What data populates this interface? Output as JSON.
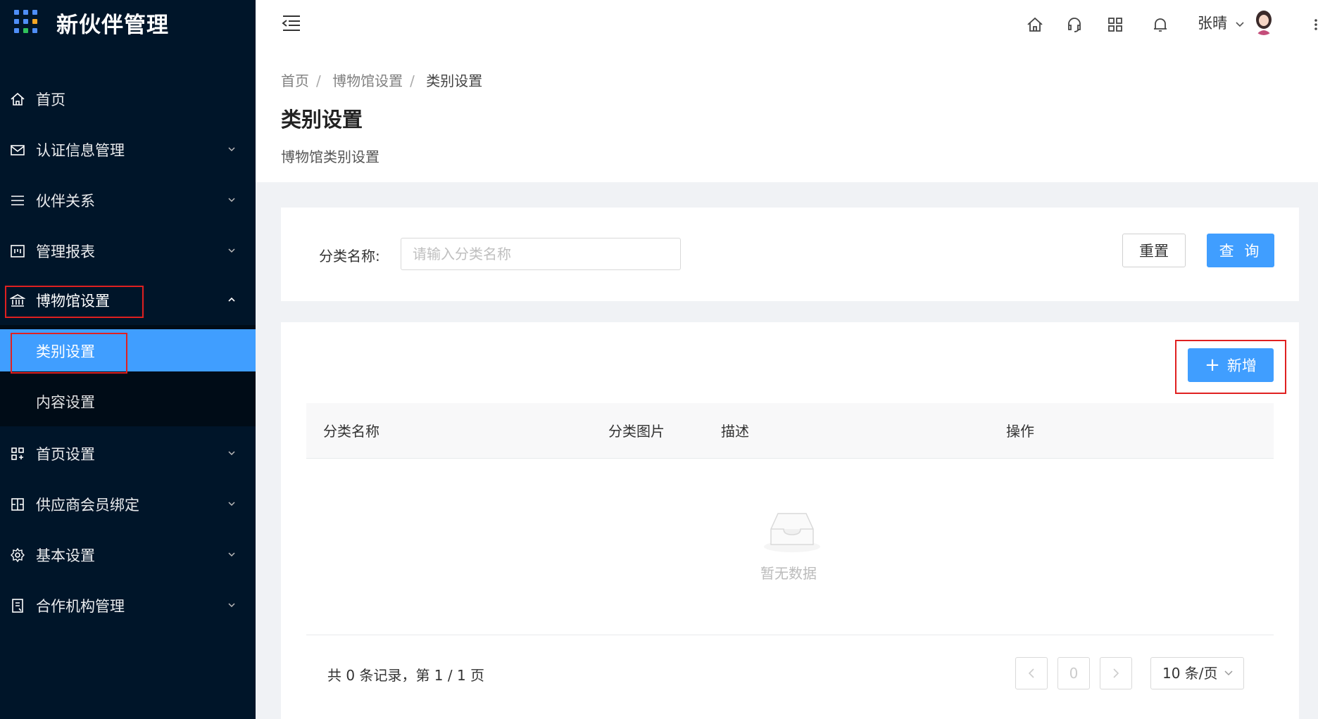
{
  "app": {
    "title": "新伙伴管理"
  },
  "sidebar": {
    "items": [
      {
        "label": "首页",
        "icon": "home-icon"
      },
      {
        "label": "认证信息管理",
        "icon": "mail-icon",
        "expandable": true
      },
      {
        "label": "伙伴关系",
        "icon": "list-icon",
        "expandable": true
      },
      {
        "label": "管理报表",
        "icon": "report-icon",
        "expandable": true
      },
      {
        "label": "博物馆设置",
        "icon": "museum-icon",
        "expandable": true,
        "expanded": true
      },
      {
        "label": "首页设置",
        "icon": "grid-icon",
        "expandable": true
      },
      {
        "label": "供应商会员绑定",
        "icon": "bind-icon",
        "expandable": true
      },
      {
        "label": "基本设置",
        "icon": "gear-icon",
        "expandable": true
      },
      {
        "label": "合作机构管理",
        "icon": "org-icon",
        "expandable": true
      }
    ],
    "submenu": [
      {
        "label": "类别设置",
        "active": true
      },
      {
        "label": "内容设置",
        "active": false
      }
    ],
    "active_color": "#409eff",
    "highlight_color": "#e02020"
  },
  "header": {
    "icons": [
      "menu-fold-icon",
      "home-icon",
      "headset-icon",
      "apps-icon",
      "bell-icon",
      "more-icon"
    ],
    "user_name": "张晴"
  },
  "breadcrumb": [
    "首页",
    "博物馆设置",
    "类别设置"
  ],
  "page": {
    "title": "类别设置",
    "description": "博物馆类别设置"
  },
  "search": {
    "label": "分类名称:",
    "placeholder": "请输入分类名称",
    "value": "",
    "reset_label": "重置",
    "query_label": "查 询"
  },
  "table": {
    "add_label": "新增",
    "columns": [
      "分类名称",
      "分类图片",
      "描述",
      "操作"
    ],
    "rows": [],
    "empty_text": "暂无数据"
  },
  "pagination": {
    "total_text": "共 0 条记录，第 1 / 1 页",
    "current_page": "0",
    "page_size": "10 条/页"
  },
  "colors": {
    "primary": "#409eff",
    "sidebar_bg": "#001529"
  }
}
